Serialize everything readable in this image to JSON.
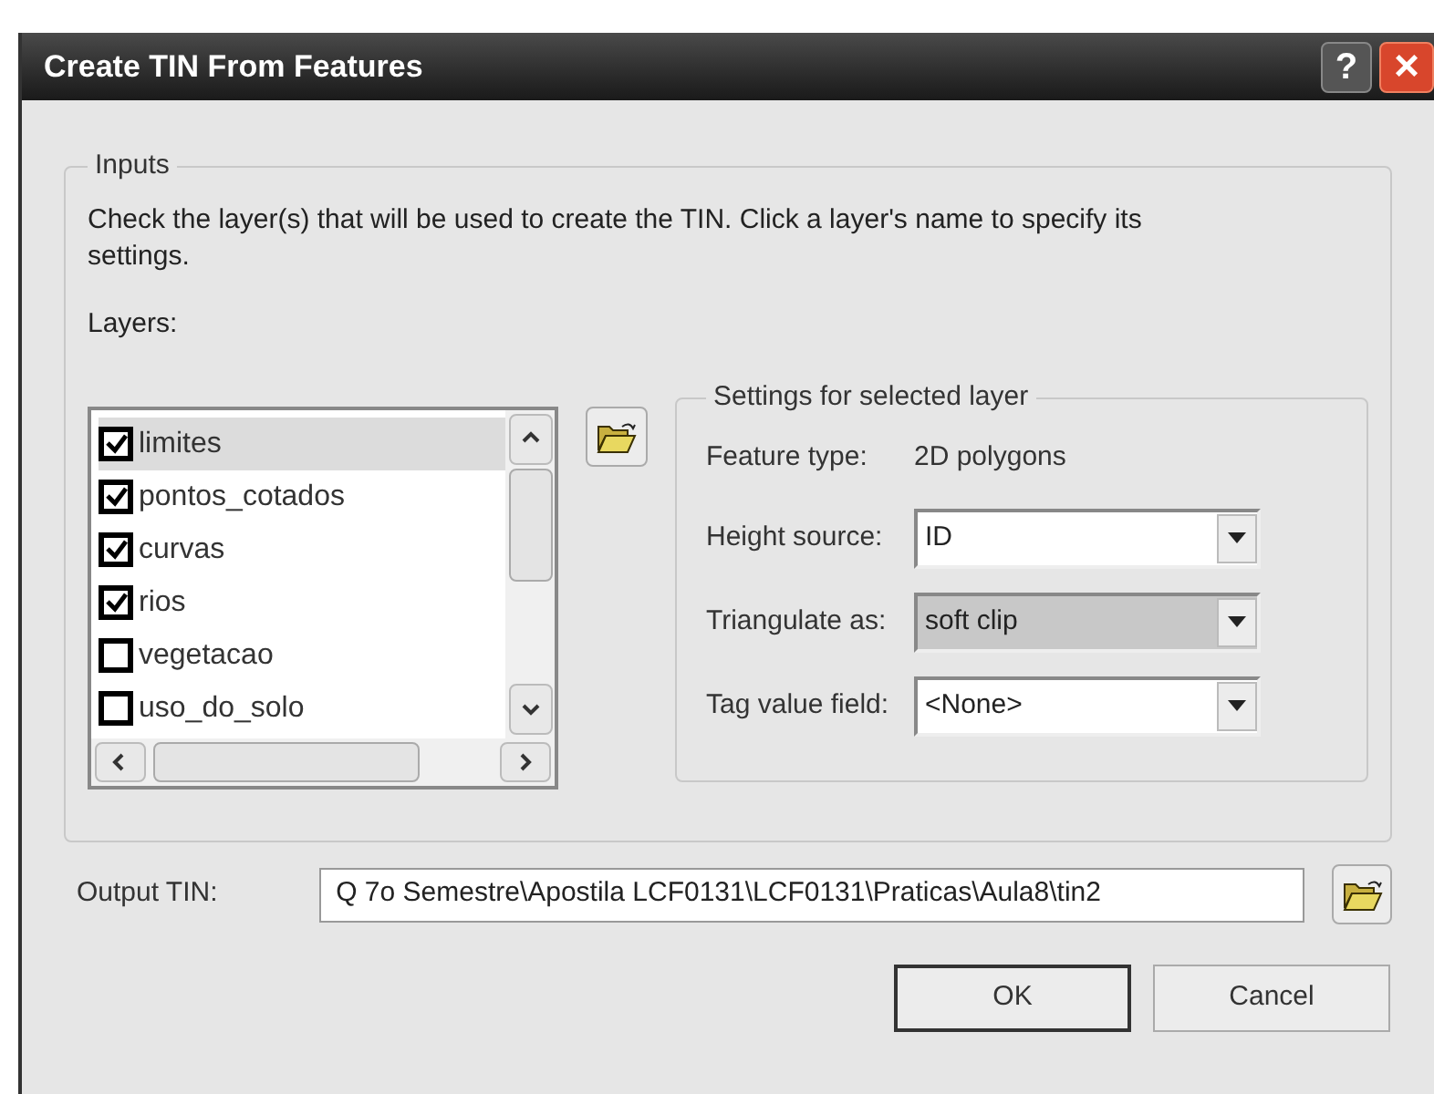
{
  "window": {
    "title": "Create TIN From Features",
    "help": "?",
    "close": "×"
  },
  "inputs": {
    "title": "Inputs",
    "instructions": "Check the layer(s) that will be used to create the TIN.  Click a layer's name to specify its settings.",
    "layers_label": "Layers:",
    "layers": [
      {
        "name": "limites",
        "checked": true,
        "selected": true
      },
      {
        "name": "pontos_cotados",
        "checked": true,
        "selected": false
      },
      {
        "name": "curvas",
        "checked": true,
        "selected": false
      },
      {
        "name": "rios",
        "checked": true,
        "selected": false
      },
      {
        "name": "vegetacao",
        "checked": false,
        "selected": false
      },
      {
        "name": "uso_do_solo",
        "checked": false,
        "selected": false
      }
    ],
    "settings": {
      "title": "Settings for selected layer",
      "feature_type_label": "Feature type:",
      "feature_type": "2D polygons",
      "fields": [
        {
          "label": "Height source:",
          "value": "ID",
          "disabled": false
        },
        {
          "label": "Triangulate as:",
          "value": "soft clip",
          "disabled": true
        },
        {
          "label": "Tag value field:",
          "value": "<None>",
          "disabled": false
        }
      ]
    }
  },
  "output": {
    "label": "Output TIN:",
    "value": "Q 7o Semestre\\Apostila LCF0131\\LCF0131\\Praticas\\Aula8\\tin2"
  },
  "buttons": [
    {
      "label": "OK",
      "default": true
    },
    {
      "label": "Cancel",
      "default": false
    }
  ]
}
